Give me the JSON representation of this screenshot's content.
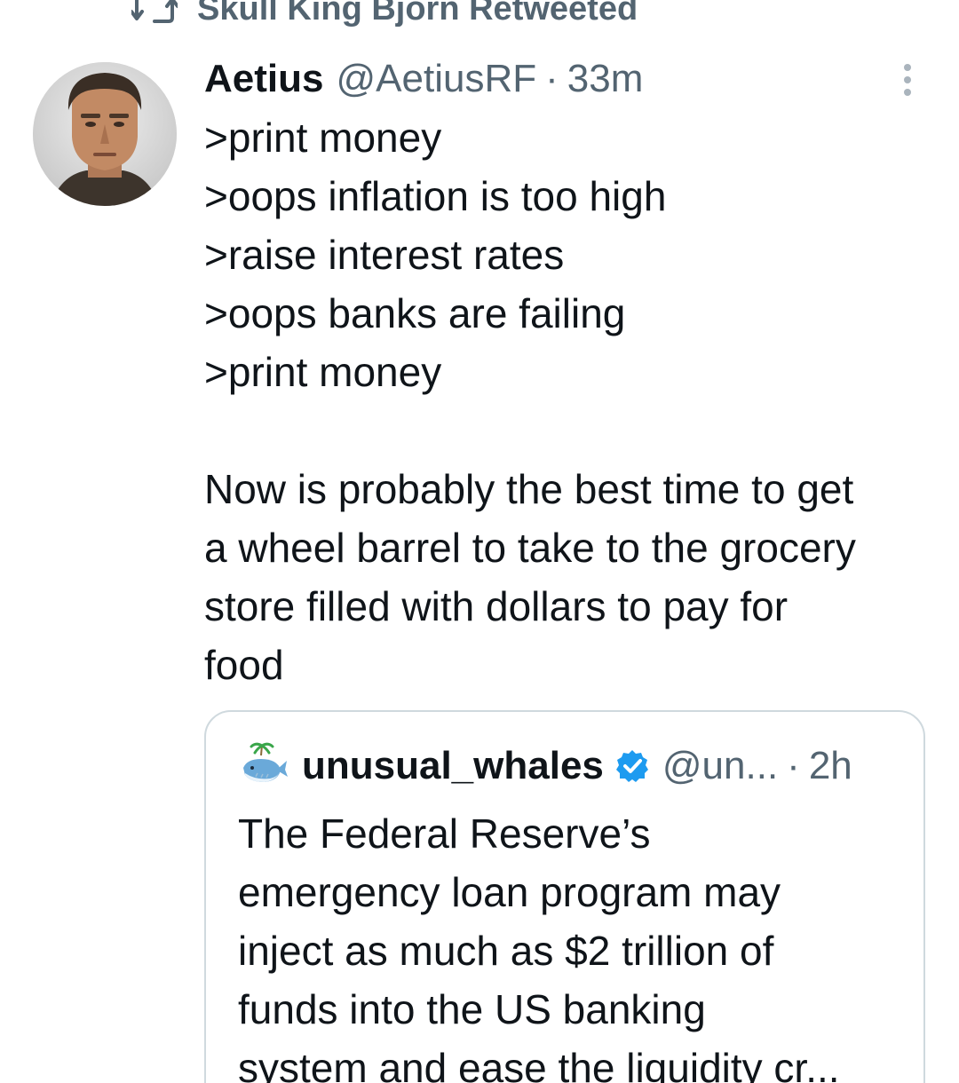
{
  "retweet": {
    "label": "Skull King Bjorn Retweeted"
  },
  "tweet": {
    "display_name": "Aetius",
    "handle": "@AetiusRF",
    "separator": "·",
    "time": "33m",
    "lines": [
      ">print money",
      ">oops inflation is too high",
      ">raise interest rates",
      ">oops banks are failing",
      ">print money",
      "",
      "Now is probably the best time to get",
      "a wheel barrel to take to the grocery",
      "store filled with dollars to pay for",
      "food"
    ]
  },
  "quote": {
    "display_name": "unusual_whales",
    "handle": "@un...",
    "separator": "·",
    "time": "2h",
    "lines": [
      "The Federal Reserve’s",
      "emergency loan program may",
      "inject as much as $2 trillion of",
      "funds into the US banking",
      "system and ease the liquidity cr..."
    ]
  },
  "icons": {
    "retweet": "retweet-icon",
    "more": "more-options-icon",
    "verified": "verified-badge-icon",
    "quote_avatar": "whale-avatar-icon"
  },
  "colors": {
    "text_primary": "#0f1419",
    "text_secondary": "#536471",
    "verified_blue": "#1d9bf0",
    "card_border": "#cfd9de"
  }
}
